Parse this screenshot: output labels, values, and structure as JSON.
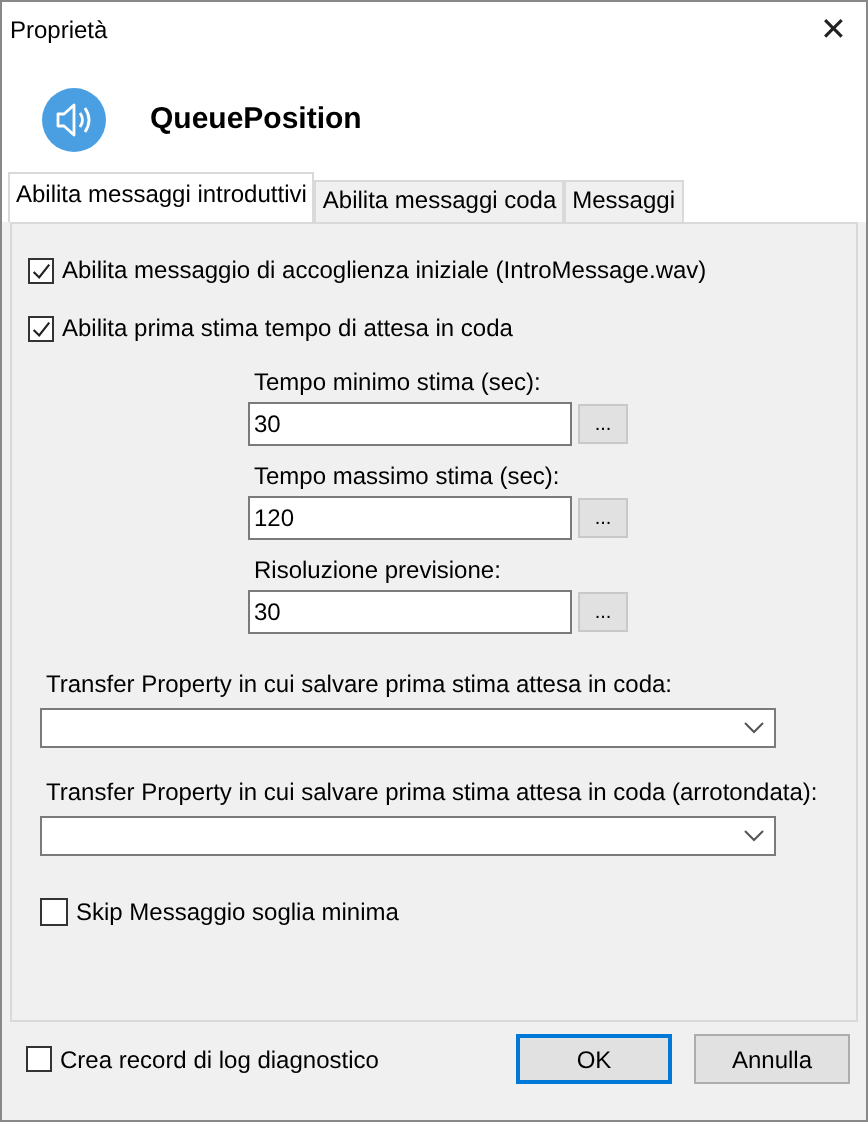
{
  "window": {
    "title": "Proprietà",
    "close": "✕"
  },
  "header": {
    "title": "QueuePosition"
  },
  "tabs": [
    {
      "label": "Abilita messaggi introduttivi",
      "selected": true
    },
    {
      "label": "Abilita messaggi coda",
      "selected": false
    },
    {
      "label": "Messaggi",
      "selected": false
    }
  ],
  "checks": [
    {
      "label": "Abilita messaggio di accoglienza iniziale (IntroMessage.wav)",
      "checked": true
    },
    {
      "label": "Abilita prima stima tempo di attesa in coda",
      "checked": true
    }
  ],
  "fields": [
    {
      "label": "Tempo minimo stima (sec):",
      "value": "30",
      "button": "..."
    },
    {
      "label": "Tempo massimo stima (sec):",
      "value": "120",
      "button": "..."
    },
    {
      "label": "Risoluzione previsione:",
      "value": "30",
      "button": "..."
    }
  ],
  "dropdowns": [
    {
      "label": "Transfer Property in cui salvare prima stima attesa in coda:"
    },
    {
      "label": "Transfer Property in cui salvare prima stima attesa in coda (arrotondata):"
    }
  ],
  "skip": {
    "label": "Skip Messaggio soglia minima",
    "checked": false
  },
  "footer": {
    "log": {
      "label": "Crea record di log diagnostico",
      "checked": false
    },
    "buttons": [
      {
        "label": "OK",
        "default": true
      },
      {
        "label": "Annulla",
        "default": false
      }
    ]
  }
}
